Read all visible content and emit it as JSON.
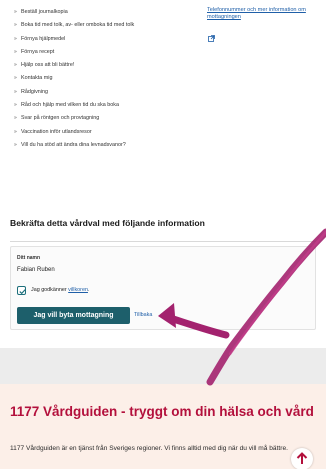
{
  "services": [
    "Beställ journalkopia",
    "Boka tid med tolk, av- eller omboka tid med tolk",
    "Förnya hjälpmedel",
    "Förnya recept",
    "Hjälp oss att bli bättre!",
    "Kontakta mig",
    "Rådgivning",
    "Råd och hjälp med vilken tid du ska boka",
    "Svar på röntgen och provtagning",
    "Vaccination inför utlandsresor",
    "Vill du ha stöd att ändra dina levnadsvanor?"
  ],
  "side_link": "Telefonnummer och mer information om mottagningen",
  "confirm": {
    "title": "Bekräfta detta vårdval med följande information",
    "name_label": "Ditt namn",
    "name_value": "Fabian Ruben",
    "consent_prefix": "Jag godkänner ",
    "consent_link": "villkoren",
    "consent_suffix": ".",
    "consent_checked": true,
    "primary_button": "Jag vill byta mottagning",
    "secondary_link": "Tillbaka"
  },
  "footer": {
    "title": "1177 Vårdguiden - tryggt om din hälsa och vård",
    "text": "1177 Vårdguiden är en tjänst från Sveriges regioner. Vi finns alltid med dig när du vill må bättre."
  },
  "colors": {
    "button": "#1d5f6b",
    "link": "#1f5fa8",
    "footer_title": "#b3103c",
    "footer_bg": "#fcefe8",
    "arrow": "#a3226e"
  },
  "icons": {
    "external_link": "external-link-icon",
    "checkmark": "checkmark-icon",
    "back_to_top": "arrow-up-icon",
    "annotation": "annotation-arrow"
  }
}
